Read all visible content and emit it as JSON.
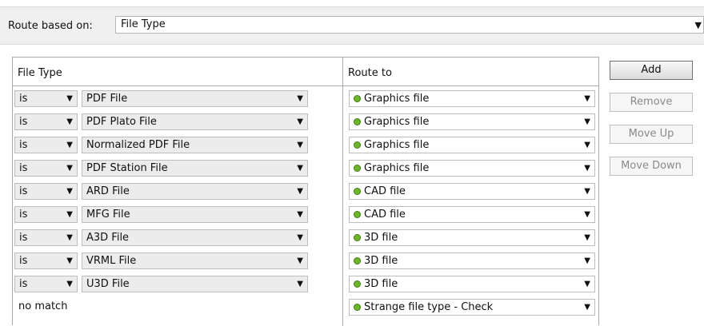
{
  "route_based_on": {
    "label": "Route based on:",
    "value": "File Type"
  },
  "table": {
    "headers": {
      "file_type": "File Type",
      "route_to": "Route to"
    },
    "rows": [
      {
        "op": "is",
        "file_type": "PDF File",
        "route": "Graphics file"
      },
      {
        "op": "is",
        "file_type": "PDF Plato File",
        "route": "Graphics file"
      },
      {
        "op": "is",
        "file_type": "Normalized PDF File",
        "route": "Graphics file"
      },
      {
        "op": "is",
        "file_type": "PDF Station File",
        "route": "Graphics file"
      },
      {
        "op": "is",
        "file_type": "ARD File",
        "route": "CAD file"
      },
      {
        "op": "is",
        "file_type": "MFG File",
        "route": "CAD file"
      },
      {
        "op": "is",
        "file_type": "A3D File",
        "route": "3D file"
      },
      {
        "op": "is",
        "file_type": "VRML File",
        "route": "3D file"
      },
      {
        "op": "is",
        "file_type": "U3D File",
        "route": "3D file"
      }
    ],
    "no_match": {
      "label": "no match",
      "route": "Strange file type - Check"
    }
  },
  "buttons": {
    "add": "Add",
    "remove": "Remove",
    "move_up": "Move Up",
    "move_down": "Move Down"
  },
  "colors": {
    "status_dot": "#6fb52c"
  }
}
